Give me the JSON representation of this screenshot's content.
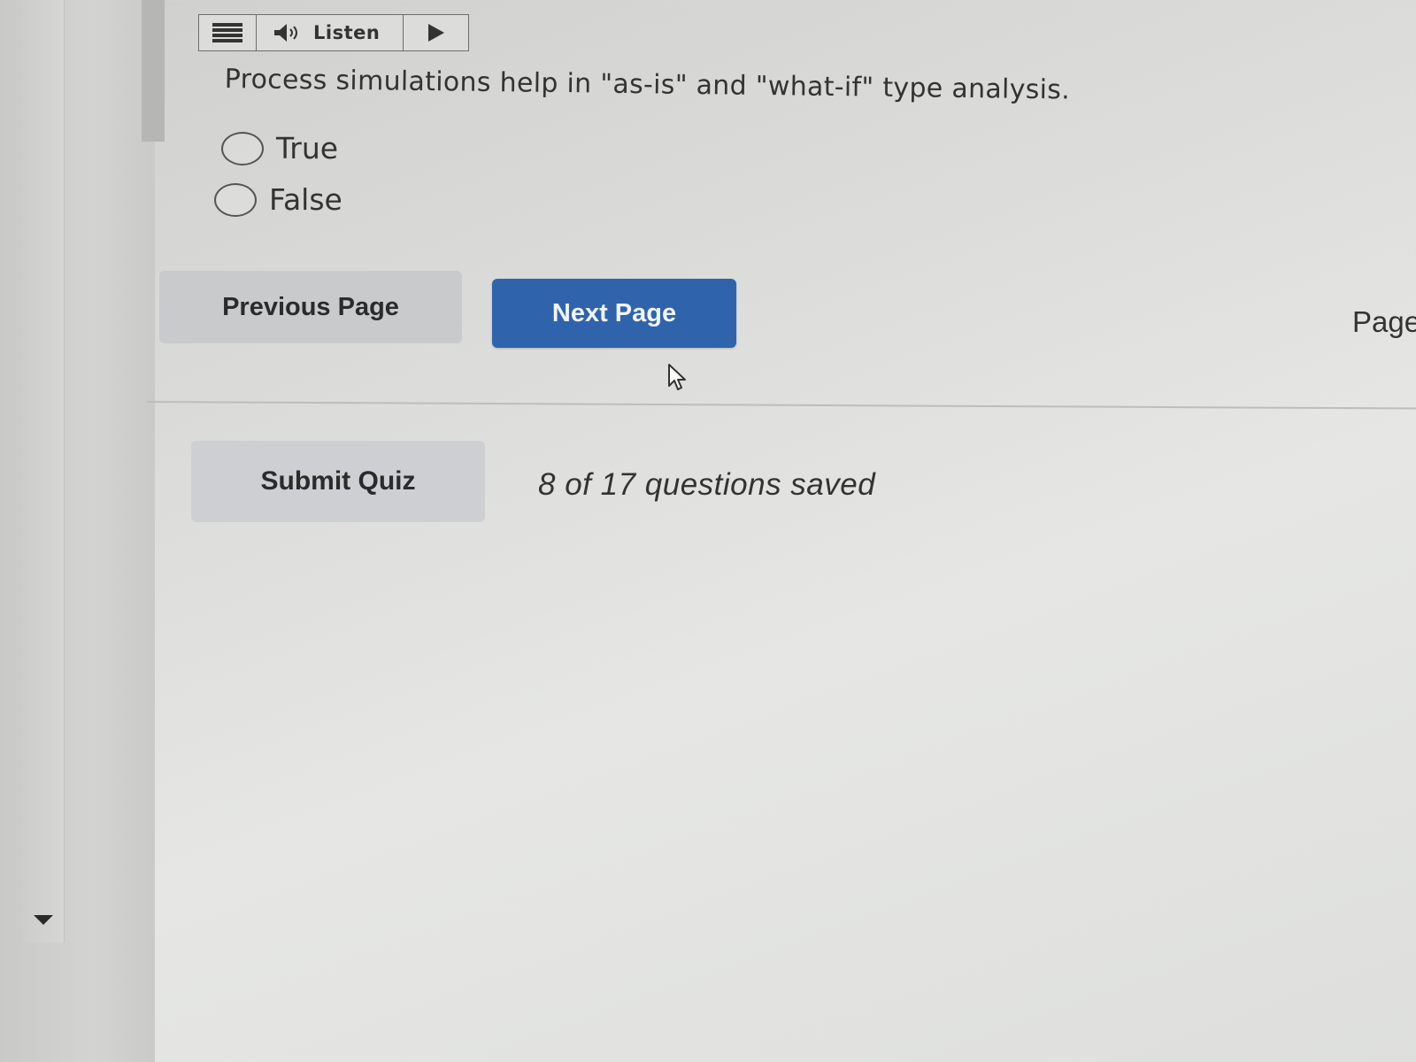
{
  "toolbar": {
    "menu_icon": "hamburger-menu-icon",
    "speaker_icon": "speaker-icon",
    "listen_label": "Listen",
    "play_icon": "play-icon"
  },
  "question": {
    "text": "Process simulations help in \"as-is\" and \"what-if\" type analysis.",
    "options": [
      {
        "label": "True",
        "selected": false
      },
      {
        "label": "False",
        "selected": false
      }
    ]
  },
  "navigation": {
    "previous_label": "Previous Page",
    "next_label": "Next Page",
    "right_edge_label": "Page"
  },
  "footer": {
    "submit_label": "Submit Quiz",
    "saved_status": "8 of 17 questions saved"
  },
  "colors": {
    "primary_button": "#2f64ad",
    "secondary_button": "#c9cacc",
    "text": "#333333"
  }
}
